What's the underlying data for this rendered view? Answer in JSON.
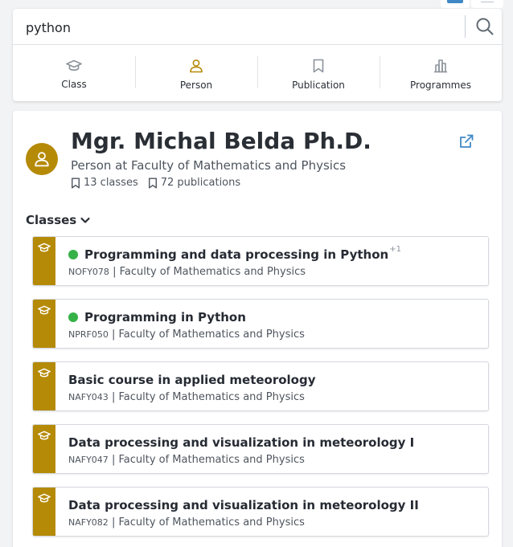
{
  "search": {
    "value": "python",
    "icon": "magnifier-icon"
  },
  "filters": [
    {
      "label": "Class",
      "icon": "graduation-cap-icon"
    },
    {
      "label": "Person",
      "icon": "person-icon"
    },
    {
      "label": "Publication",
      "icon": "bookmark-icon"
    },
    {
      "label": "Programmes",
      "icon": "building-icon"
    }
  ],
  "colors": {
    "accent": "#b58a07",
    "active_status": "#35b148",
    "link": "#3f88c5"
  },
  "person": {
    "name": "Mgr. Michal Belda Ph.D.",
    "role": "Person at Faculty of Mathematics and Physics",
    "classes_count": "13 classes",
    "publications_count": "72 publications"
  },
  "classes_section": {
    "title": "Classes"
  },
  "classes": [
    {
      "title": "Programming and data processing in Python",
      "extra": "+1",
      "active": true,
      "code": "NOFY078",
      "separator": "|",
      "faculty": "Faculty of Mathematics and Physics"
    },
    {
      "title": "Programming in Python",
      "extra": "",
      "active": true,
      "code": "NPRF050",
      "separator": "|",
      "faculty": "Faculty of Mathematics and Physics"
    },
    {
      "title": "Basic course in applied meteorology",
      "extra": "",
      "active": false,
      "code": "NAFY043",
      "separator": "|",
      "faculty": "Faculty of Mathematics and Physics"
    },
    {
      "title": "Data processing and visualization in meteorology I",
      "extra": "",
      "active": false,
      "code": "NAFY047",
      "separator": "|",
      "faculty": "Faculty of Mathematics and Physics"
    },
    {
      "title": "Data processing and visualization in meteorology II",
      "extra": "",
      "active": false,
      "code": "NAFY082",
      "separator": "|",
      "faculty": "Faculty of Mathematics and Physics"
    }
  ]
}
